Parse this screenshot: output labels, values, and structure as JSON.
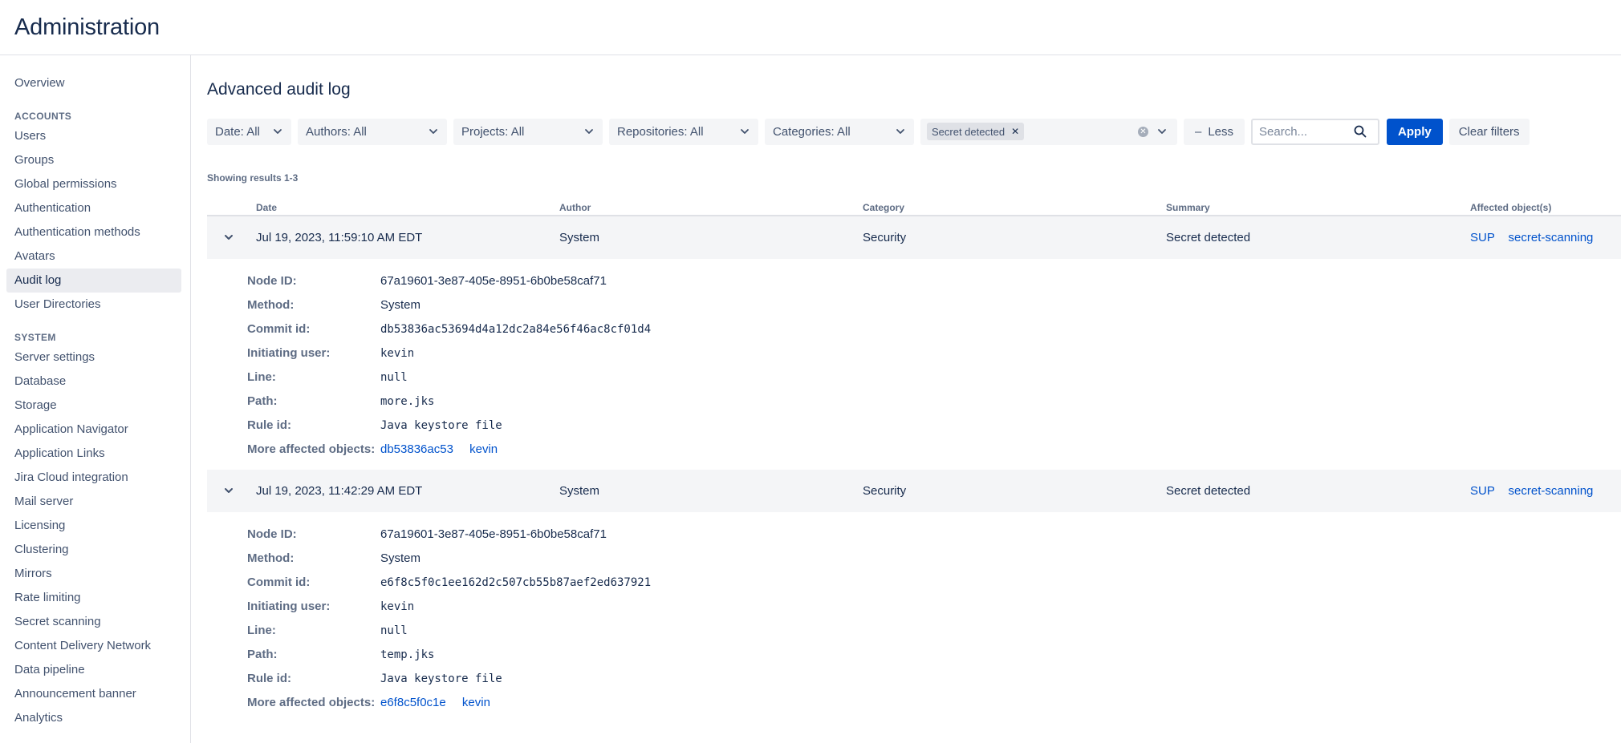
{
  "app": {
    "title": "Administration"
  },
  "sidebar": {
    "top": [
      {
        "label": "Overview"
      }
    ],
    "accounts_heading": "ACCOUNTS",
    "accounts": [
      {
        "label": "Users"
      },
      {
        "label": "Groups"
      },
      {
        "label": "Global permissions"
      },
      {
        "label": "Authentication"
      },
      {
        "label": "Authentication methods"
      },
      {
        "label": "Avatars"
      },
      {
        "label": "Audit log",
        "active": true
      },
      {
        "label": "User Directories"
      }
    ],
    "system_heading": "SYSTEM",
    "system": [
      {
        "label": "Server settings"
      },
      {
        "label": "Database"
      },
      {
        "label": "Storage"
      },
      {
        "label": "Application Navigator"
      },
      {
        "label": "Application Links"
      },
      {
        "label": "Jira Cloud integration"
      },
      {
        "label": "Mail server"
      },
      {
        "label": "Licensing"
      },
      {
        "label": "Clustering"
      },
      {
        "label": "Mirrors"
      },
      {
        "label": "Rate limiting"
      },
      {
        "label": "Secret scanning"
      },
      {
        "label": "Content Delivery Network"
      },
      {
        "label": "Data pipeline"
      },
      {
        "label": "Announcement banner"
      },
      {
        "label": "Analytics"
      }
    ]
  },
  "main": {
    "title": "Advanced audit log",
    "filters": {
      "date": "Date: All",
      "authors": "Authors: All",
      "projects": "Projects: All",
      "repositories": "Repositories: All",
      "categories": "Categories: All",
      "selected_tag": "Secret detected",
      "less_label": "Less",
      "search_placeholder": "Search...",
      "apply_label": "Apply",
      "clear_label": "Clear filters"
    },
    "results_text": "Showing results 1-3",
    "columns": {
      "date": "Date",
      "author": "Author",
      "category": "Category",
      "summary": "Summary",
      "affected": "Affected object(s)"
    },
    "rows": [
      {
        "date": "Jul 19, 2023, 11:59:10 AM EDT",
        "author": "System",
        "category": "Security",
        "summary": "Secret detected",
        "affected": [
          "SUP",
          "secret-scanning"
        ],
        "details": {
          "node_id_label": "Node ID:",
          "node_id": "67a19601-3e87-405e-8951-6b0be58caf71",
          "method_label": "Method:",
          "method": "System",
          "commit_label": "Commit id:",
          "commit": "db53836ac53694d4a12dc2a84e56f46ac8cf01d4",
          "user_label": "Initiating user:",
          "user": "kevin",
          "line_label": "Line:",
          "line": "null",
          "path_label": "Path:",
          "path": "more.jks",
          "rule_label": "Rule id:",
          "rule": "Java keystore file",
          "more_label": "More affected objects:",
          "more": [
            "db53836ac53",
            "kevin"
          ]
        }
      },
      {
        "date": "Jul 19, 2023, 11:42:29 AM EDT",
        "author": "System",
        "category": "Security",
        "summary": "Secret detected",
        "affected": [
          "SUP",
          "secret-scanning"
        ],
        "details": {
          "node_id_label": "Node ID:",
          "node_id": "67a19601-3e87-405e-8951-6b0be58caf71",
          "method_label": "Method:",
          "method": "System",
          "commit_label": "Commit id:",
          "commit": "e6f8c5f0c1ee162d2c507cb55b87aef2ed637921",
          "user_label": "Initiating user:",
          "user": "kevin",
          "line_label": "Line:",
          "line": "null",
          "path_label": "Path:",
          "path": "temp.jks",
          "rule_label": "Rule id:",
          "rule": "Java keystore file",
          "more_label": "More affected objects:",
          "more": [
            "e6f8c5f0c1e",
            "kevin"
          ]
        }
      }
    ]
  }
}
